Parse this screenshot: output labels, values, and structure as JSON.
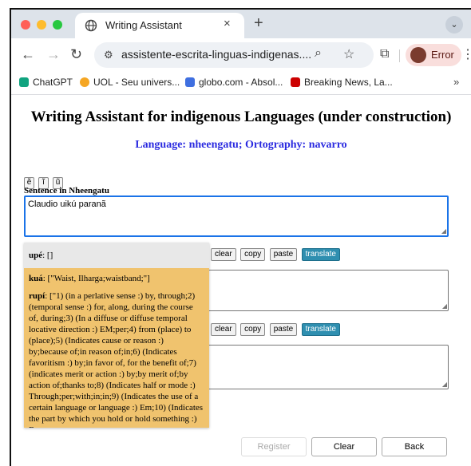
{
  "browser": {
    "tab": {
      "title": "Writing Assistant",
      "close": "×"
    },
    "new_tab": "+",
    "tab_menu": "⌄",
    "url": "assistente-escrita-linguas-indigenas....",
    "profile_label": "Error",
    "bookmarks": [
      {
        "label": "ChatGPT",
        "color": "#10a37f"
      },
      {
        "label": "UOL - Seu univers...",
        "color": "#f5a623"
      },
      {
        "label": "globo.com - Absol...",
        "color": "#3f6fe0"
      },
      {
        "label": "Breaking News, La...",
        "color": "#cc0000"
      }
    ],
    "bookmarks_more": "»"
  },
  "page": {
    "title": "Writing Assistant for indigenous Languages (under construction)",
    "subtitle": "Language: nheengatu; Ortography: navarro",
    "char_buttons": [
      "ẽ",
      "ĩ",
      "ũ"
    ],
    "sentence_label": "Sentence in Nheengatu",
    "sentence_value": "Claudio uikú paranã",
    "actions": {
      "clear": "clear",
      "copy": "copy",
      "paste": "paste",
      "translate": "translate"
    },
    "suggestions": [
      {
        "word": "upé",
        "meaning": ": []"
      },
      {
        "word": "kuá",
        "meaning": ": [\"Waist, Ilharga;waistband;\"]"
      },
      {
        "word": "rupí",
        "meaning": ": [\"1) (in a perlative sense :) by, through;2) (temporal sense :) for, along, during the course of, during;3) (In a diffuse or diffuse temporal locative direction :) EM;per;4) from (place) to (place);5) (Indicates cause or reason :) by;because of;in reason of;in;6) (Indicates favoritism :) by;in favor of, for the benefit of;7) (indicates merit or action :) by;by merit of;by action of;thanks to;8) (Indicates half or mode :) Through;per;with;in;in;9) (Indicates the use of a certain language or language :) Em;10) (Indicates the part by which you hold or hold something :) By..."
      }
    ],
    "bottom_buttons": {
      "register": "Register",
      "clear": "Clear",
      "back": "Back"
    }
  }
}
